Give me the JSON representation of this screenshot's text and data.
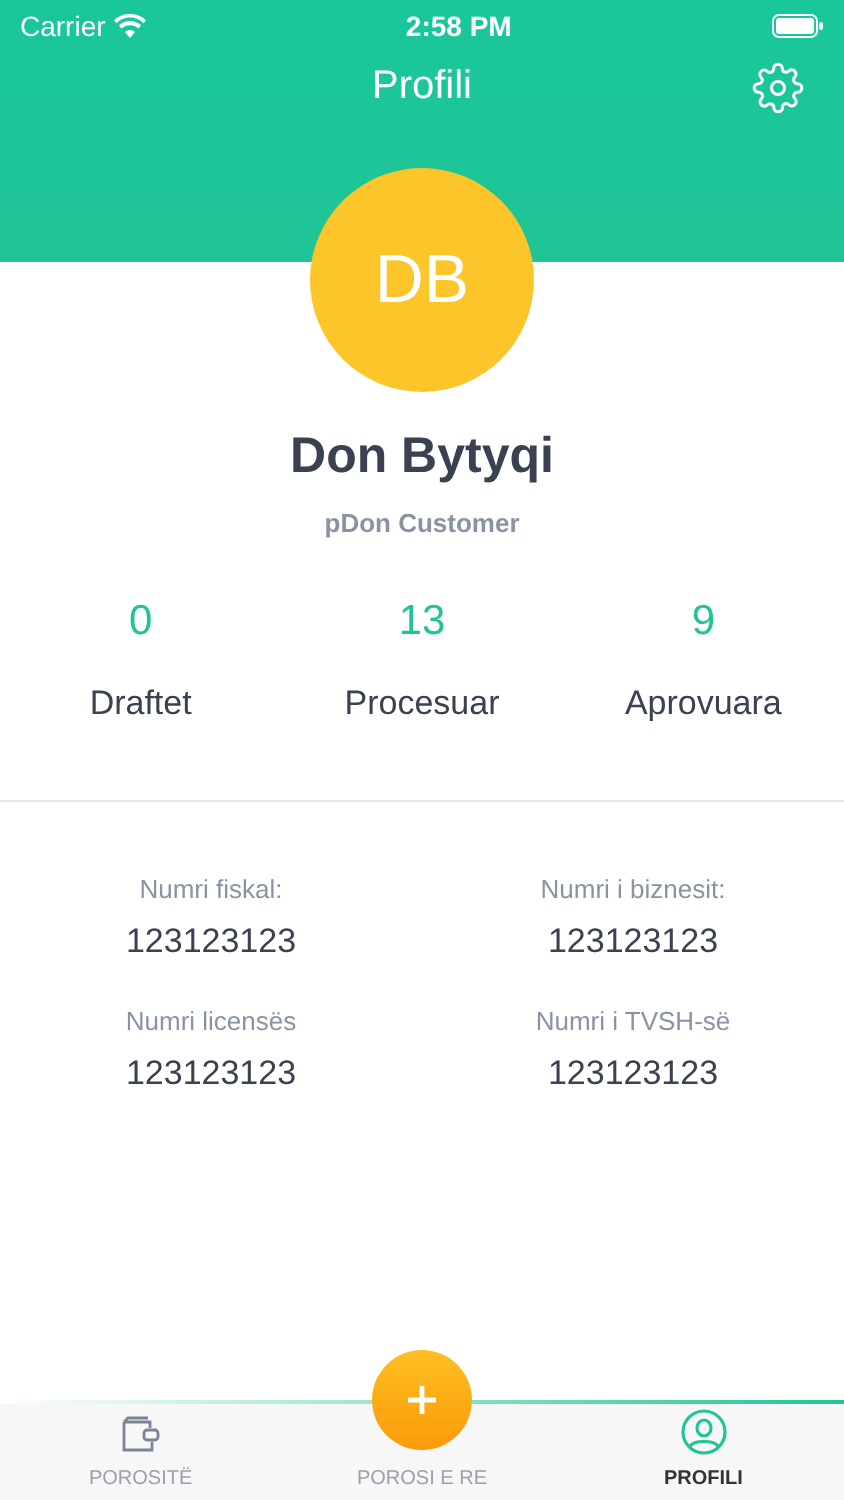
{
  "status_bar": {
    "carrier": "Carrier",
    "time": "2:58 PM"
  },
  "header": {
    "title": "Profili"
  },
  "profile": {
    "initials": "DB",
    "name": "Don Bytyqi",
    "role": "pDon Customer"
  },
  "stats": [
    {
      "value": "0",
      "label": "Draftet"
    },
    {
      "value": "13",
      "label": "Procesuar"
    },
    {
      "value": "9",
      "label": "Aprovuara"
    }
  ],
  "details": [
    {
      "label": "Numri fiskal:",
      "value": "123123123"
    },
    {
      "label": "Numri i biznesit:",
      "value": "123123123"
    },
    {
      "label": "Numri licensës",
      "value": "123123123"
    },
    {
      "label": "Numri i TVSH-së",
      "value": "123123123"
    }
  ],
  "tab_bar": [
    {
      "kind": "wallet",
      "label": "POROSITË",
      "selected": false
    },
    {
      "kind": "plus",
      "label": "POROSI E RE",
      "selected": false
    },
    {
      "kind": "person",
      "label": "PROFILI",
      "selected": true
    }
  ]
}
